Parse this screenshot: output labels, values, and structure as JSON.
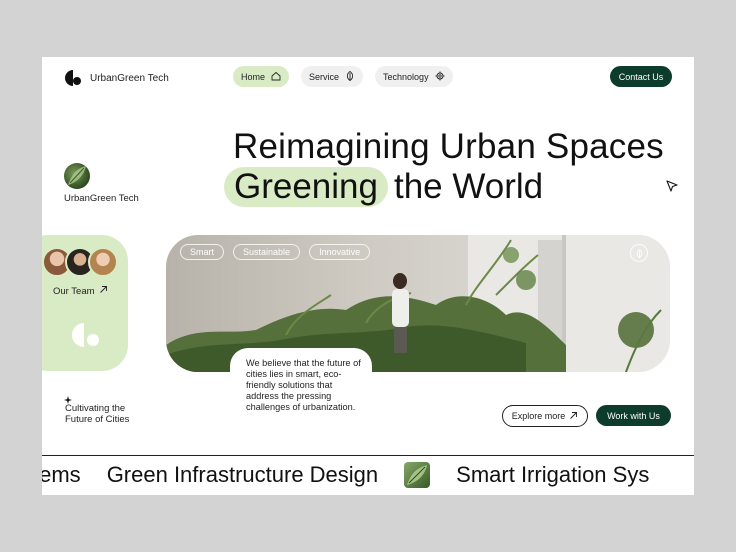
{
  "brand": {
    "name": "UrbanGreen Tech"
  },
  "nav": {
    "items": [
      {
        "label": "Home",
        "icon": "home-icon",
        "active": true
      },
      {
        "label": "Service",
        "icon": "leaf-icon",
        "active": false
      },
      {
        "label": "Technology",
        "icon": "gear-icon",
        "active": false
      }
    ],
    "contact_label": "Contact Us"
  },
  "hero": {
    "line1": "Reimagining Urban Spaces",
    "highlight": "Greening",
    "line2_rest": "the World",
    "brand_label": "UrbanGreen Tech"
  },
  "team": {
    "label": "Our Team"
  },
  "tagline": "Cultivating the Future of Cities",
  "panel": {
    "tags": [
      "Smart",
      "Sustainable",
      "Innovative"
    ],
    "quote": "We believe that the future of cities lies in smart, eco-friendly solutions that address the pressing challenges of urbanization."
  },
  "actions": {
    "explore_label": "Explore more",
    "work_label": "Work with Us"
  },
  "marquee": {
    "items": [
      "stems",
      "Green Infrastructure Design",
      "Smart Irrigation Sys"
    ]
  },
  "colors": {
    "accent": "#d9ebc5",
    "dark": "#0d3b2c",
    "background": "#d3d3d3"
  }
}
